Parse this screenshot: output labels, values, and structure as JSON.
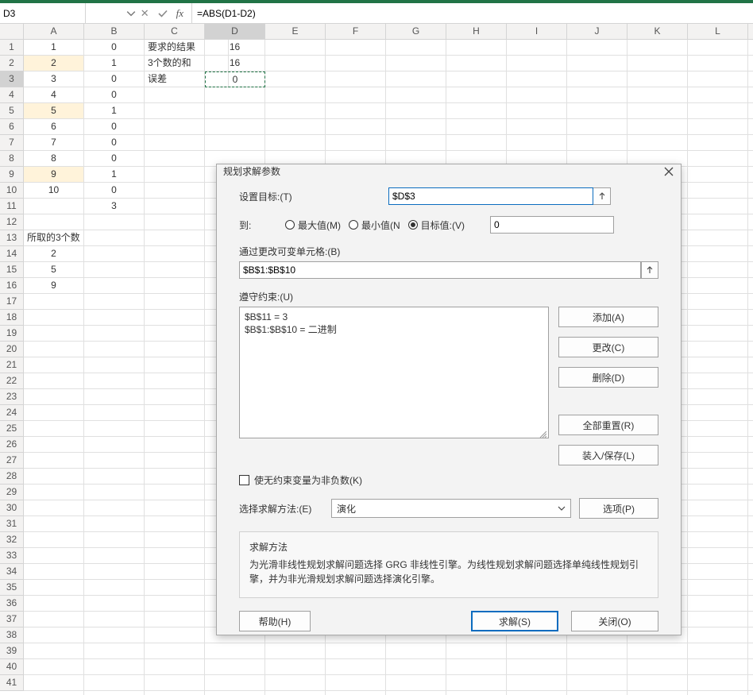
{
  "name_box": "D3",
  "formula": "=ABS(D1-D2)",
  "columns": [
    "A",
    "B",
    "C",
    "D",
    "E",
    "F",
    "G",
    "H",
    "I",
    "J",
    "K",
    "L"
  ],
  "row_count": 41,
  "active_col_index": 3,
  "active_row_index": 2,
  "highlighted_rows_A": [
    1,
    4,
    8
  ],
  "sheet": {
    "A": {
      "1": "1",
      "2": "2",
      "3": "3",
      "4": "4",
      "5": "5",
      "6": "6",
      "7": "7",
      "8": "8",
      "9": "9",
      "10": "10",
      "13": "所取的3个数",
      "14": "2",
      "15": "5",
      "16": "9"
    },
    "B": {
      "1": "0",
      "2": "1",
      "3": "0",
      "4": "0",
      "5": "1",
      "6": "0",
      "7": "0",
      "8": "0",
      "9": "1",
      "10": "0",
      "11": "3"
    },
    "C": {
      "1": "要求的结果",
      "2": "3个数的和",
      "3": "误差"
    },
    "D": {
      "1": "16",
      "2": "16",
      "3": "0"
    }
  },
  "dialog": {
    "title": "规划求解参数",
    "set_target_label": "设置目标:(T)",
    "set_target_value": "$D$3",
    "to_label": "到:",
    "radio_max": "最大值(M)",
    "radio_min": "最小值(N",
    "radio_valueof": "目标值:(V)",
    "radio_selected": "valueof",
    "target_val": "0",
    "changing_label": "通过更改可变单元格:(B)",
    "changing_value": "$B$1:$B$10",
    "constraints_label": "遵守约束:(U)",
    "constraints": [
      "$B$11 = 3",
      "$B$1:$B$10 = 二进制"
    ],
    "btn_add": "添加(A)",
    "btn_change": "更改(C)",
    "btn_delete": "删除(D)",
    "btn_resetall": "全部重置(R)",
    "btn_loadsave": "装入/保存(L)",
    "chk_nonneg": "使无约束变量为非负数(K)",
    "method_label": "选择求解方法:(E)",
    "method_value": "演化",
    "btn_options": "选项(P)",
    "desc_title": "求解方法",
    "desc_body": "为光滑非线性规划求解问题选择 GRG 非线性引擎。为线性规划求解问题选择单纯线性规划引擎，并为非光滑规划求解问题选择演化引擎。",
    "btn_help": "帮助(H)",
    "btn_solve": "求解(S)",
    "btn_close": "关闭(O)"
  }
}
